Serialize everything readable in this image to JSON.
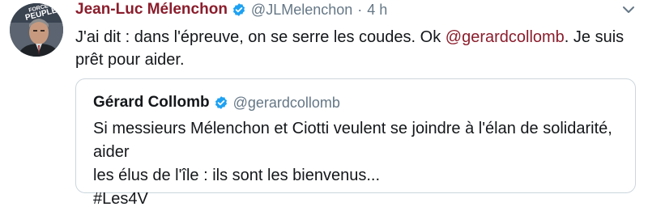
{
  "tweet": {
    "author_name": "Jean-Luc Mélenchon",
    "author_handle": "@JLMelenchon",
    "separator": "·",
    "time": "4 h",
    "text_before": "J'ai dit : dans l'épreuve, on se serre les coudes. Ok ",
    "mention": "@gerardcollomb",
    "text_after": ". Je suis prêt pour aider.",
    "avatar_banner_text": "FORCE DU PEUPLE",
    "avatar_banner_line1": "FORCE DU",
    "avatar_banner_line2": "PEUPLE"
  },
  "quoted_tweet": {
    "author_name": "Gérard Collomb",
    "author_handle": "@gerardcollomb",
    "text_line1": "Si messieurs Mélenchon et Ciotti veulent se joindre à l'élan de solidarité, aider",
    "text_line2": "les élus de l'île : ils sont les bienvenus...",
    "hashtag": "#Les4V"
  },
  "icons": {
    "verified": "verified-badge-icon",
    "caret": "chevron-down-icon"
  },
  "colors": {
    "author_name": "#8b1d2c",
    "mention": "#8b1d2c",
    "verified": "#1da1f2",
    "secondary_text": "#657786",
    "quote_border": "#ccd6dd"
  }
}
